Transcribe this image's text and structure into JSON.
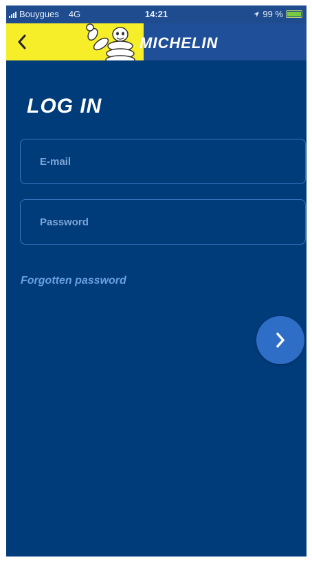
{
  "status_bar": {
    "carrier": "Bouygues",
    "network": "4G",
    "time": "14:21",
    "battery_text": "99 %",
    "battery_level": 0.99
  },
  "header": {
    "brand": "MICHELIN",
    "back_icon": "chevron-left-icon",
    "mascot_icon": "michelin-man-icon"
  },
  "page": {
    "title": "LOG IN"
  },
  "form": {
    "email": {
      "value": "",
      "placeholder": "E-mail"
    },
    "password": {
      "value": "",
      "placeholder": "Password"
    },
    "forgot_label": "Forgotten password",
    "next_icon": "chevron-right-icon"
  },
  "colors": {
    "background": "#003b7a",
    "header_blue": "#1f4f98",
    "header_yellow": "#f7ee2a",
    "accent": "#2f6ec6",
    "link": "#6aa0e0"
  }
}
